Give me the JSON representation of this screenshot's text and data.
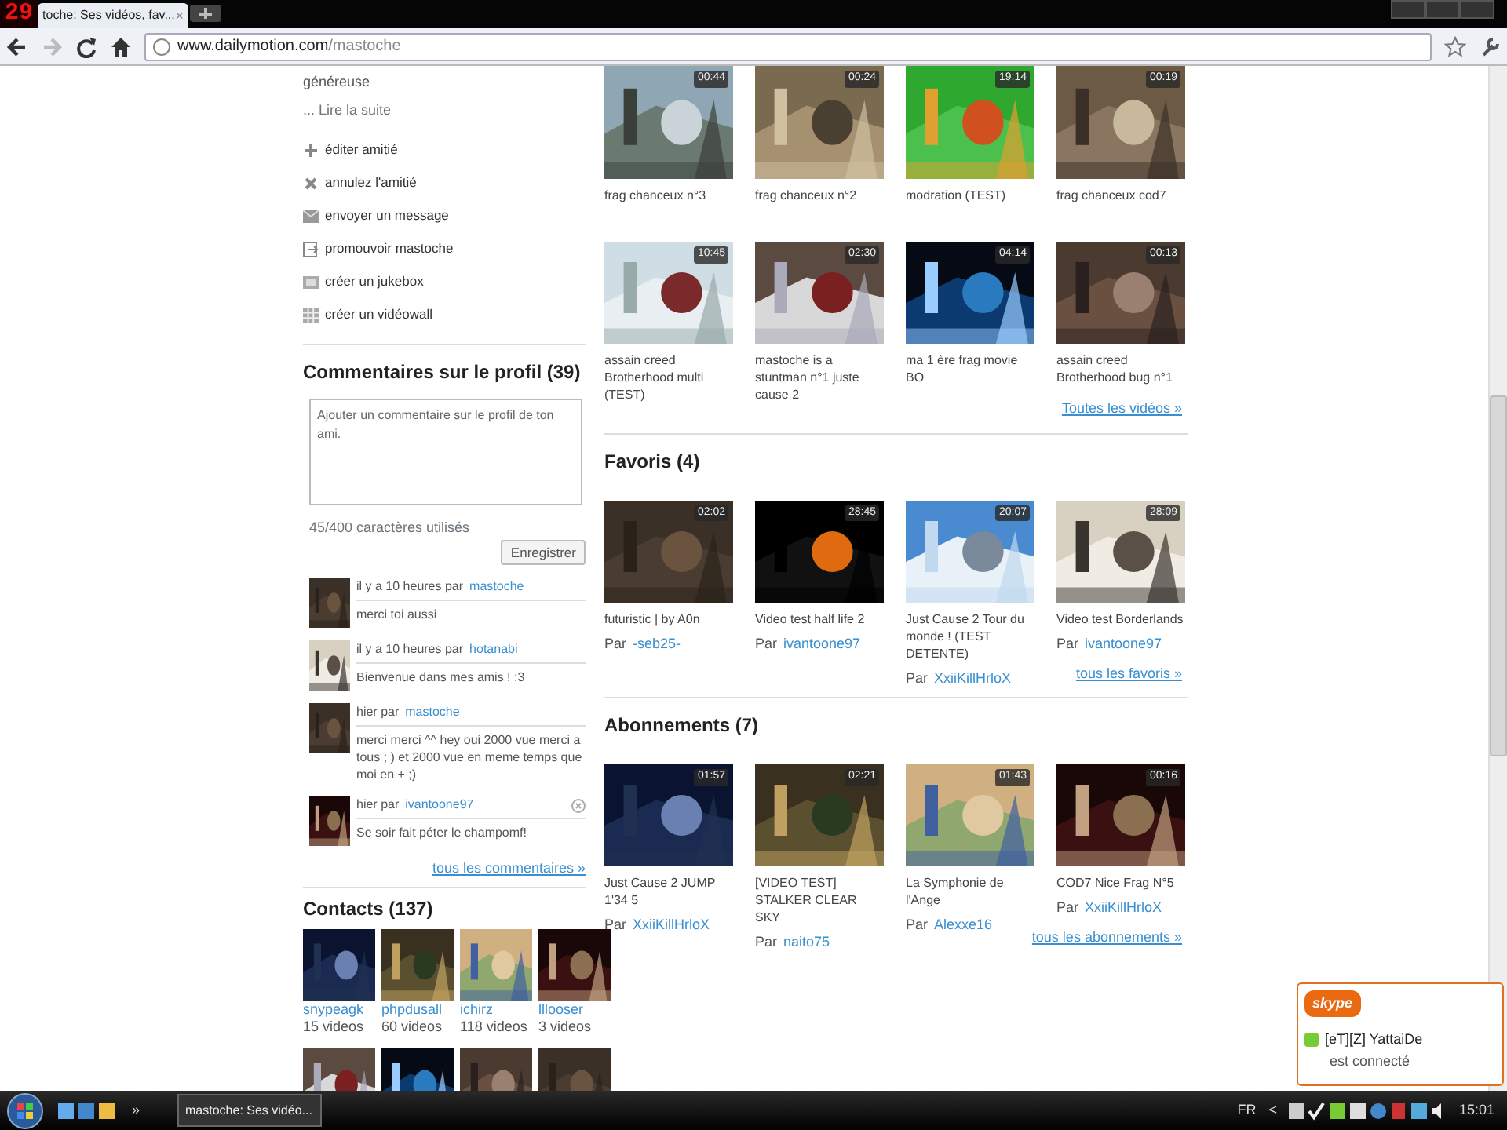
{
  "browser": {
    "fps_counter": "29",
    "tab_title": "toche: Ses vidéos, fav...",
    "tab_close": "×",
    "url_host": "www.dailymotion.com",
    "url_path": "/mastoche"
  },
  "sidebar": {
    "bio_tail": "généreuse",
    "read_more": "... Lire la suite",
    "actions": [
      {
        "label": "éditer amitié",
        "kind": "plus"
      },
      {
        "label": "annulez l'amitié",
        "kind": "cross"
      },
      {
        "label": "envoyer un message",
        "kind": "message"
      },
      {
        "label": "promouvoir mastoche",
        "kind": "promote"
      },
      {
        "label": "créer un jukebox",
        "kind": "jukebox"
      },
      {
        "label": "créer un vidéowall",
        "kind": "wall"
      }
    ],
    "comments_section": {
      "title": "Commentaires sur le profil (39)",
      "placeholder": "Ajouter un commentaire sur le profil de ton ami.",
      "char_count": "45/400 caractères utilisés",
      "submit": "Enregistrer",
      "comments": [
        {
          "time": "il y a 10 heures par",
          "author": "mastoche",
          "text": "merci toi aussi",
          "deletable": false
        },
        {
          "time": "il y a 10 heures par",
          "author": "hotanabi",
          "text": "Bienvenue dans mes amis ! :3",
          "deletable": false
        },
        {
          "time": "hier par",
          "author": "mastoche",
          "text": "merci merci ^^ hey oui 2000 vue merci a tous ; ) et 2000 vue en meme temps que moi en + ;)",
          "deletable": false
        },
        {
          "time": "hier par",
          "author": "ivantoone97",
          "text": "Se soir fait péter le champomf!",
          "deletable": true
        }
      ],
      "all_link": "tous les commentaires »"
    },
    "contacts": {
      "title": "Contacts (137)",
      "items": [
        {
          "name": "snypeagk",
          "count": "15 videos"
        },
        {
          "name": "phpdusall",
          "count": "60 videos"
        },
        {
          "name": "ichirz",
          "count": "118 videos"
        },
        {
          "name": "lllooser",
          "count": "3 videos"
        }
      ]
    }
  },
  "videos": {
    "items": [
      {
        "title": "frag chanceux n°3",
        "duration": "00:44"
      },
      {
        "title": "frag chanceux n°2",
        "duration": "00:24"
      },
      {
        "title": "modration (TEST)",
        "duration": "19:14"
      },
      {
        "title": "frag chanceux cod7",
        "duration": "00:19"
      },
      {
        "title": "assain creed Brotherhood multi (TEST)",
        "duration": "10:45"
      },
      {
        "title": "mastoche is a stuntman n°1 juste cause 2",
        "duration": "02:30"
      },
      {
        "title": "ma 1 ère frag movie BO",
        "duration": "04:14"
      },
      {
        "title": "assain creed Brotherhood bug n°1",
        "duration": "00:13"
      }
    ],
    "all_link": "Toutes les vidéos »"
  },
  "favorites": {
    "title": "Favoris (4)",
    "items": [
      {
        "title": "futuristic | by A0n",
        "duration": "02:02",
        "by": "Par",
        "author": "-seb25-"
      },
      {
        "title": "Video test half life 2",
        "duration": "28:45",
        "by": "Par",
        "author": "ivantoone97"
      },
      {
        "title": "Just Cause 2 Tour du monde ! (TEST DETENTE)",
        "duration": "20:07",
        "by": "Par",
        "author": "XxiiKillHrloX"
      },
      {
        "title": "Video test Borderlands",
        "duration": "28:09",
        "by": "Par",
        "author": "ivantoone97"
      }
    ],
    "all_link": "tous les favoris »"
  },
  "subscriptions": {
    "title": "Abonnements (7)",
    "items": [
      {
        "title": "Just Cause 2 JUMP 1'34 5",
        "duration": "01:57",
        "by": "Par",
        "author": "XxiiKillHrloX"
      },
      {
        "title": "[VIDEO TEST] STALKER CLEAR SKY",
        "duration": "02:21",
        "by": "Par",
        "author": "naito75"
      },
      {
        "title": "La Symphonie de l'Ange",
        "duration": "01:43",
        "by": "Par",
        "author": "Alexxe16"
      },
      {
        "title": "COD7 Nice Frag N°5",
        "duration": "00:16",
        "by": "Par",
        "author": "XxiiKillHrloX"
      }
    ],
    "all_link": "tous les abonnements »"
  },
  "skype_popup": {
    "logo": "skype",
    "contact": "[eT][Z] YattaiDe",
    "status": "est connecté"
  },
  "taskbar": {
    "overflow": "»",
    "task": "mastoche: Ses vidéo...",
    "language": "FR",
    "tray_expand": "<",
    "clock": "15:01"
  }
}
